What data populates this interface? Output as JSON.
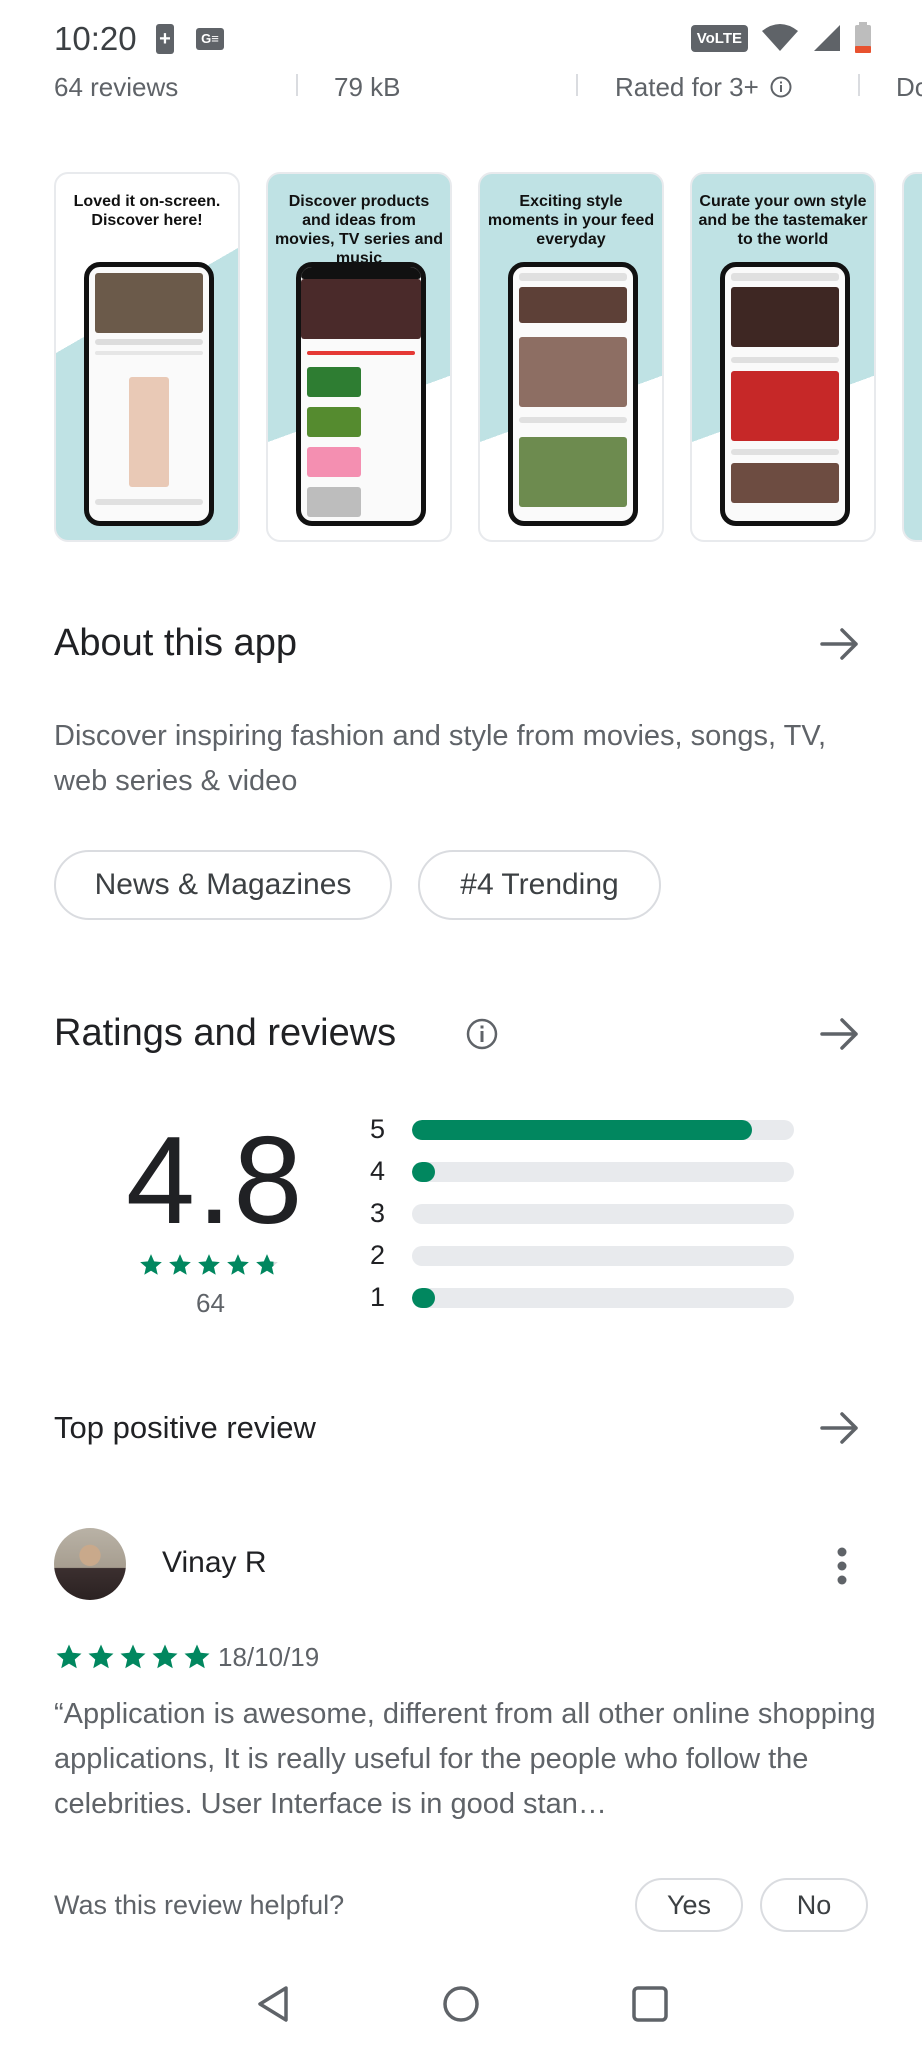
{
  "status_bar": {
    "time": "10:20",
    "battery_icon_text": "+",
    "ge_text": "G≡",
    "volte": "VoLTE"
  },
  "info_row": {
    "reviews": "64 reviews",
    "size": "79 kB",
    "rated": "Rated for 3+",
    "partial": "Do"
  },
  "screenshots": [
    {
      "caption": "Loved it on-screen. Discover here!"
    },
    {
      "caption": "Discover products and ideas from movies, TV series and music"
    },
    {
      "caption": "Exciting style moments in your feed everyday"
    },
    {
      "caption": "Curate your own style and be the tastemaker to the world"
    }
  ],
  "about": {
    "title": "About this app",
    "description": "Discover inspiring fashion and style from movies, songs, TV, web series & video",
    "chips": [
      "News & Magazines",
      "#4 Trending"
    ]
  },
  "ratings": {
    "title": "Ratings and reviews",
    "average": "4.8",
    "count": "64",
    "distribution": [
      {
        "label": "5",
        "fraction": 0.89
      },
      {
        "label": "4",
        "fraction": 0.06
      },
      {
        "label": "3",
        "fraction": 0.0
      },
      {
        "label": "2",
        "fraction": 0.0
      },
      {
        "label": "1",
        "fraction": 0.06
      }
    ],
    "stars_value": 4.8
  },
  "top_review": {
    "title": "Top positive review",
    "reviewer": "Vinay R",
    "stars": 5,
    "date": "18/10/19",
    "text": "“Application is awesome, different from all other online shopping applications, It is really useful for the people who follow the celebrities. User Interface is in good stan…",
    "helpful_question": "Was this review helpful?",
    "yes_label": "Yes",
    "no_label": "No"
  },
  "colors": {
    "accent_green": "#01875f",
    "text_primary": "#202124",
    "text_secondary": "#5f6368",
    "track": "#e8eaed"
  }
}
